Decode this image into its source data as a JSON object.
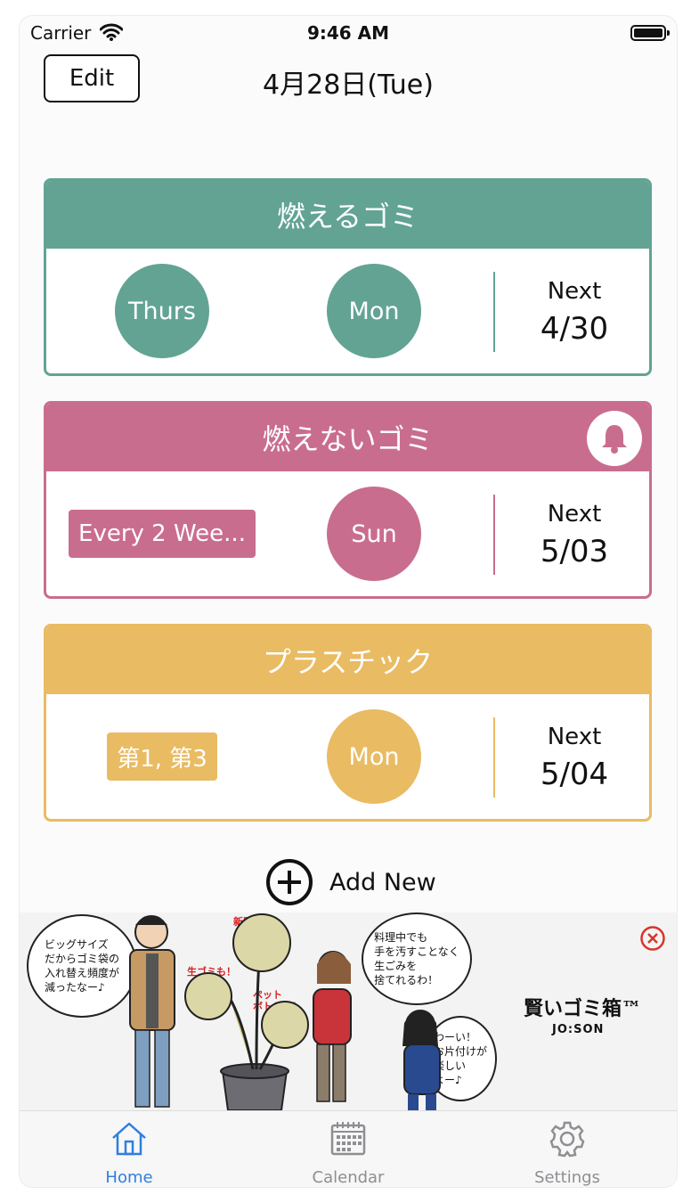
{
  "status_bar": {
    "carrier": "Carrier",
    "time": "9:46 AM"
  },
  "header": {
    "edit_label": "Edit",
    "date": "4月28日(Tue)"
  },
  "cards": [
    {
      "title": "燃えるゴミ",
      "color": "#62a394",
      "has_bell": false,
      "tag": "",
      "days": [
        "Thurs",
        "Mon"
      ],
      "next_label": "Next",
      "next_date": "4/30"
    },
    {
      "title": "燃えないゴミ",
      "color": "#c96d8f",
      "has_bell": true,
      "tag": "Every 2 Wee...",
      "days": [
        "Sun"
      ],
      "next_label": "Next",
      "next_date": "5/03"
    },
    {
      "title": "プラスチック",
      "color": "#e9bb63",
      "has_bell": false,
      "tag": "第1, 第3",
      "days": [
        "Mon"
      ],
      "next_label": "Next",
      "next_date": "5/04"
    }
  ],
  "add_new": {
    "label": "Add New",
    "icon": "plus-circle-icon"
  },
  "ad": {
    "bubble_left": "ビッグサイズ\nだからゴミ袋の\n入れ替え頻度が\n減ったなー♪",
    "bubble_center": "料理中でも\n手を汚すことなく\n生ごみを\n捨てれるわ！",
    "bubble_right": "わーい！\nお片付けが\n楽しい\nよー♪",
    "note_newspaper": "新聞紙も！",
    "note_food": "生ゴミも！",
    "note_bottle": "ペット\nボトルも！",
    "brand": "賢いゴミ箱™",
    "brand_sub": "JO:SON",
    "close_icon": "close-circle-icon"
  },
  "tabs": [
    {
      "label": "Home",
      "icon": "home-icon",
      "active": true
    },
    {
      "label": "Calendar",
      "icon": "calendar-icon",
      "active": false
    },
    {
      "label": "Settings",
      "icon": "gear-icon",
      "active": false
    }
  ]
}
